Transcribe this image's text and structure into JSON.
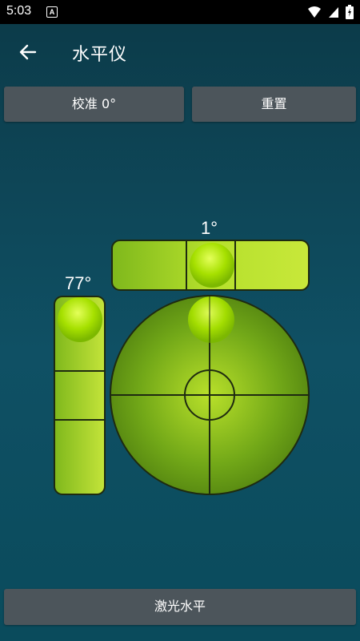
{
  "status_bar": {
    "time": "5:03",
    "notif_letter": "A"
  },
  "toolbar": {
    "title": "水平仪",
    "back_icon": "arrow-left-icon"
  },
  "buttons": {
    "calibrate": "校准 0°",
    "reset": "重置",
    "laser": "激光水平"
  },
  "readouts": {
    "horizontal": "1°",
    "vertical": "77°"
  },
  "colors": {
    "background_top": "#0c3a48",
    "background_bottom": "#0f5064",
    "button": "#4c555b",
    "level_green": "#8cc220",
    "bubble": "#a7e000"
  }
}
